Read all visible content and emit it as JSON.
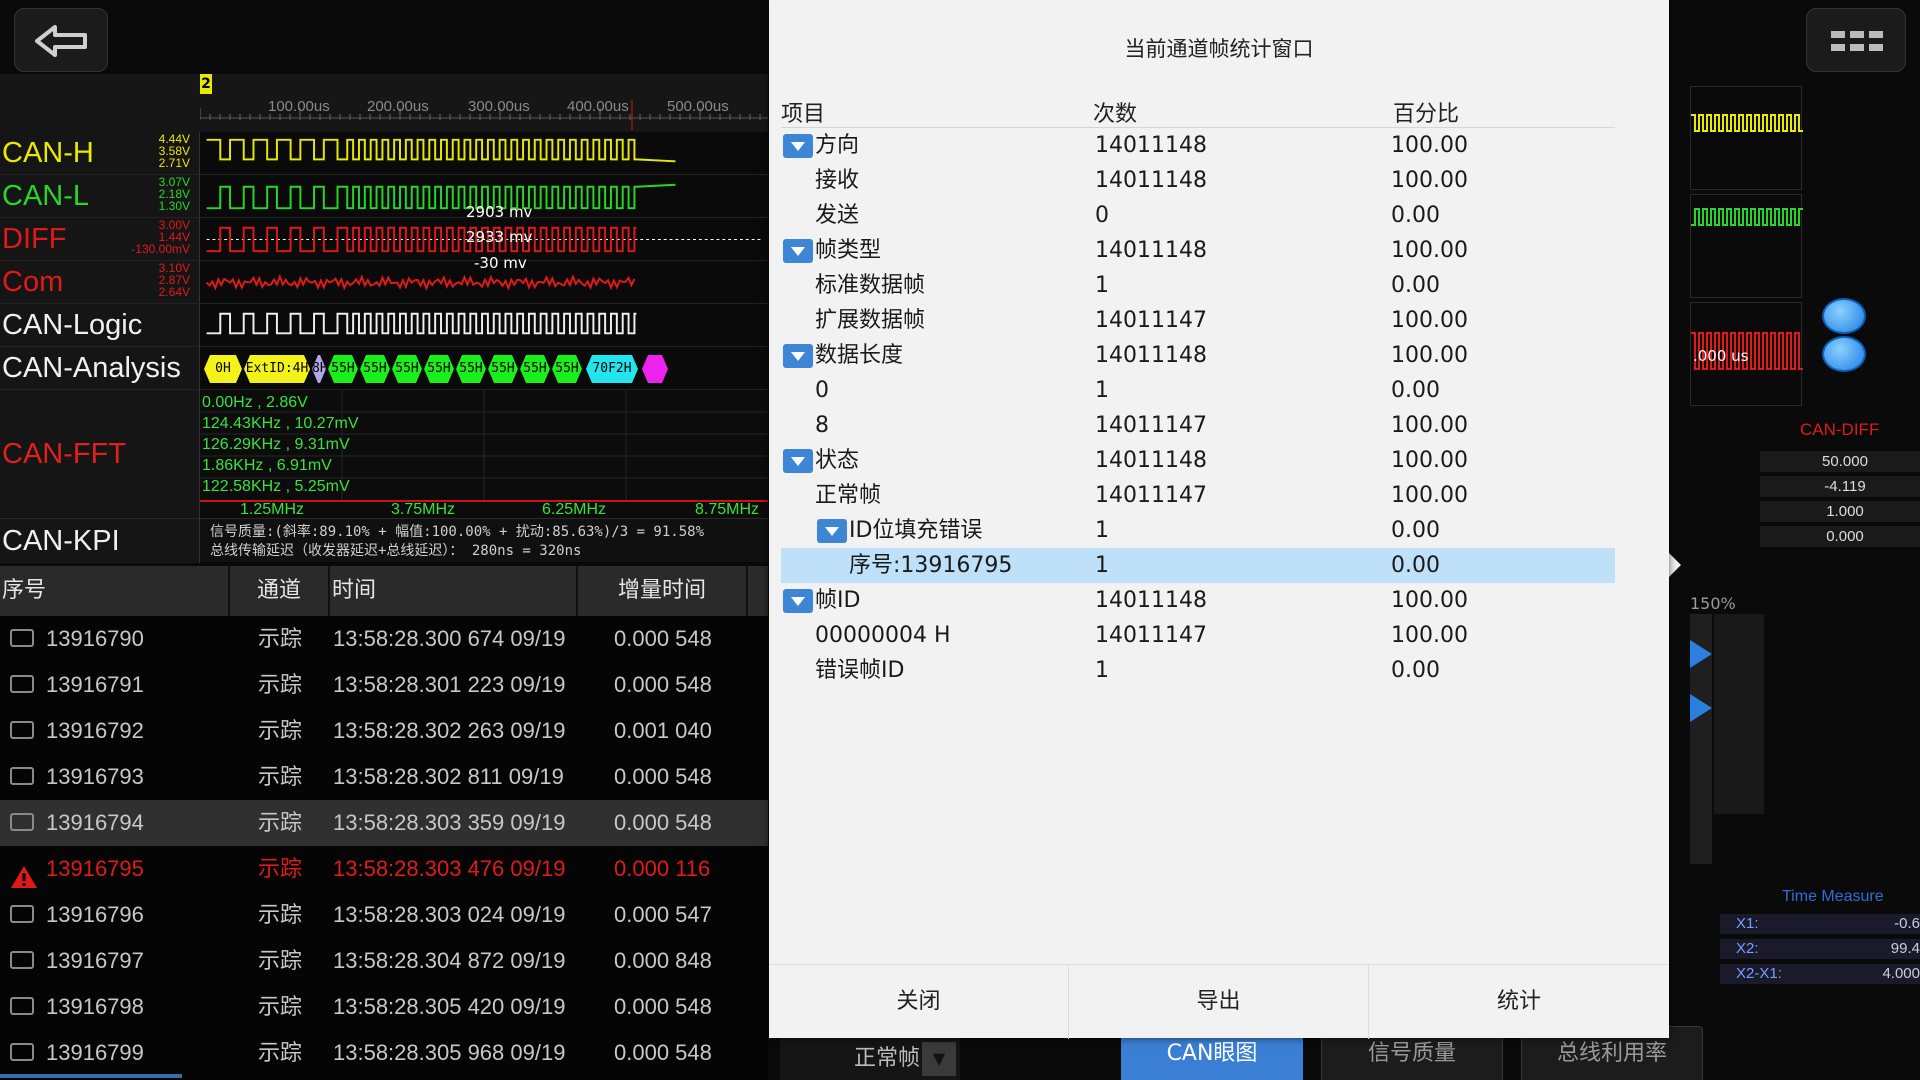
{
  "ruler": {
    "marker": "2",
    "ticks": [
      "100.00us",
      "200.00us",
      "300.00us",
      "400.00us",
      "500.00us"
    ]
  },
  "channels": [
    {
      "name": "CAN-H",
      "color": "#e8e800",
      "volts": [
        "4.44V",
        "3.58V",
        "2.71V"
      ]
    },
    {
      "name": "CAN-L",
      "color": "#27d627",
      "volts": [
        "3.07V",
        "2.18V",
        "1.30V"
      ]
    },
    {
      "name": "DIFF",
      "color": "#e01a1a",
      "volts": [
        "3.00V",
        "1.44V",
        "-130.00mV"
      ],
      "annotations": [
        "2903 mv",
        "2933 mv",
        "-30 mv"
      ]
    },
    {
      "name": "Com",
      "color": "#e01a1a",
      "volts": [
        "3.10V",
        "2.87V",
        "2.64V"
      ]
    },
    {
      "name": "CAN-Logic",
      "color": "#f0f0f0"
    },
    {
      "name": "CAN-Analysis",
      "color": "#f0f0f0",
      "segments": [
        "0H",
        "ExtID:4H",
        "8H",
        "55H",
        "55H",
        "55H",
        "55H",
        "55H",
        "55H",
        "55H",
        "55H",
        "70F2H",
        ""
      ]
    }
  ],
  "fft": {
    "name": "CAN-FFT",
    "peaks": [
      "0.00Hz , 2.86V",
      "124.43KHz , 10.27mV",
      "126.29KHz , 9.31mV",
      "1.86KHz , 6.91mV",
      "122.58KHz , 5.25mV"
    ],
    "axis": [
      "1.25MHz",
      "3.75MHz",
      "6.25MHz",
      "8.75MHz"
    ]
  },
  "kpi": {
    "name": "CAN-KPI",
    "line1": "信号质量:(斜率:89.10% + 幅值:100.00% + 扰动:85.63%)/3 = 91.58%",
    "line2": "总线传输延迟（收发器延迟+总线延迟）： 280ns = 320ns"
  },
  "table": {
    "headers": [
      "序号",
      "通道",
      "时间",
      "增量时间"
    ],
    "rows": [
      {
        "seq": "13916790",
        "ch": "示踪",
        "time": "13:58:28.300 674 09/19",
        "delta": "0.000 548"
      },
      {
        "seq": "13916791",
        "ch": "示踪",
        "time": "13:58:28.301 223 09/19",
        "delta": "0.000 548"
      },
      {
        "seq": "13916792",
        "ch": "示踪",
        "time": "13:58:28.302 263 09/19",
        "delta": "0.001 040"
      },
      {
        "seq": "13916793",
        "ch": "示踪",
        "time": "13:58:28.302 811 09/19",
        "delta": "0.000 548"
      },
      {
        "seq": "13916794",
        "ch": "示踪",
        "time": "13:58:28.303 359 09/19",
        "delta": "0.000 548"
      },
      {
        "seq": "13916795",
        "ch": "示踪",
        "time": "13:58:28.303 476 09/19",
        "delta": "0.000 116"
      },
      {
        "seq": "13916796",
        "ch": "示踪",
        "time": "13:58:28.303 024 09/19",
        "delta": "0.000 547"
      },
      {
        "seq": "13916797",
        "ch": "示踪",
        "time": "13:58:28.304 872 09/19",
        "delta": "0.000 848"
      },
      {
        "seq": "13916798",
        "ch": "示踪",
        "time": "13:58:28.305 420 09/19",
        "delta": "0.000 548"
      },
      {
        "seq": "13916799",
        "ch": "示踪",
        "time": "13:58:28.305 968 09/19",
        "delta": "0.000 548"
      }
    ],
    "selected_index": 4,
    "error_index": 5
  },
  "status_filter": {
    "label": "正常帧",
    "arrow": "▼"
  },
  "right_panel": {
    "diff_title": "CAN-DIFF",
    "diff_values": [
      "50.000",
      "-4.119",
      "1.000",
      "0.000"
    ],
    "cursor_time": ".000 us",
    "zoom": "150%",
    "time_measure_title": "Time Measure",
    "time_measure": [
      {
        "k": "X1:",
        "v": "-0.6"
      },
      {
        "k": "X2:",
        "v": "99.4"
      },
      {
        "k": "X2-X1:",
        "v": "4.000"
      }
    ]
  },
  "bottom_tabs": [
    {
      "label": "CAN眼图",
      "active": true
    },
    {
      "label": "信号质量",
      "active": false
    },
    {
      "label": "总线利用率",
      "active": false
    }
  ],
  "dialog": {
    "title": "当前通道帧统计窗口",
    "headers": [
      "项目",
      "次数",
      "百分比"
    ],
    "rows": [
      {
        "name": "方向",
        "count": "14011148",
        "pct": "100.00",
        "level": 0,
        "toggle": true
      },
      {
        "name": "接收",
        "count": "14011148",
        "pct": "100.00",
        "level": 1,
        "toggle": false
      },
      {
        "name": "发送",
        "count": "0",
        "pct": "0.00",
        "level": 1,
        "toggle": false
      },
      {
        "name": "帧类型",
        "count": "14011148",
        "pct": "100.00",
        "level": 0,
        "toggle": true
      },
      {
        "name": "标准数据帧",
        "count": "1",
        "pct": "0.00",
        "level": 1,
        "toggle": false
      },
      {
        "name": "扩展数据帧",
        "count": "14011147",
        "pct": "100.00",
        "level": 1,
        "toggle": false
      },
      {
        "name": "数据长度",
        "count": "14011148",
        "pct": "100.00",
        "level": 0,
        "toggle": true
      },
      {
        "name": "0",
        "count": "1",
        "pct": "0.00",
        "level": 1,
        "toggle": false
      },
      {
        "name": "8",
        "count": "14011147",
        "pct": "100.00",
        "level": 1,
        "toggle": false
      },
      {
        "name": "状态",
        "count": "14011148",
        "pct": "100.00",
        "level": 0,
        "toggle": true
      },
      {
        "name": "正常帧",
        "count": "14011147",
        "pct": "100.00",
        "level": 1,
        "toggle": false
      },
      {
        "name": "ID位填充错误",
        "count": "1",
        "pct": "0.00",
        "level": 1,
        "toggle": true
      },
      {
        "name": "序号:13916795",
        "count": "1",
        "pct": "0.00",
        "level": 2,
        "toggle": false,
        "highlight": true
      },
      {
        "name": "帧ID",
        "count": "14011148",
        "pct": "100.00",
        "level": 0,
        "toggle": true
      },
      {
        "name": "00000004 H",
        "count": "14011147",
        "pct": "100.00",
        "level": 1,
        "toggle": false
      },
      {
        "name": "错误帧ID",
        "count": "1",
        "pct": "0.00",
        "level": 1,
        "toggle": false
      }
    ],
    "buttons": [
      "关闭",
      "导出",
      "统计"
    ]
  }
}
